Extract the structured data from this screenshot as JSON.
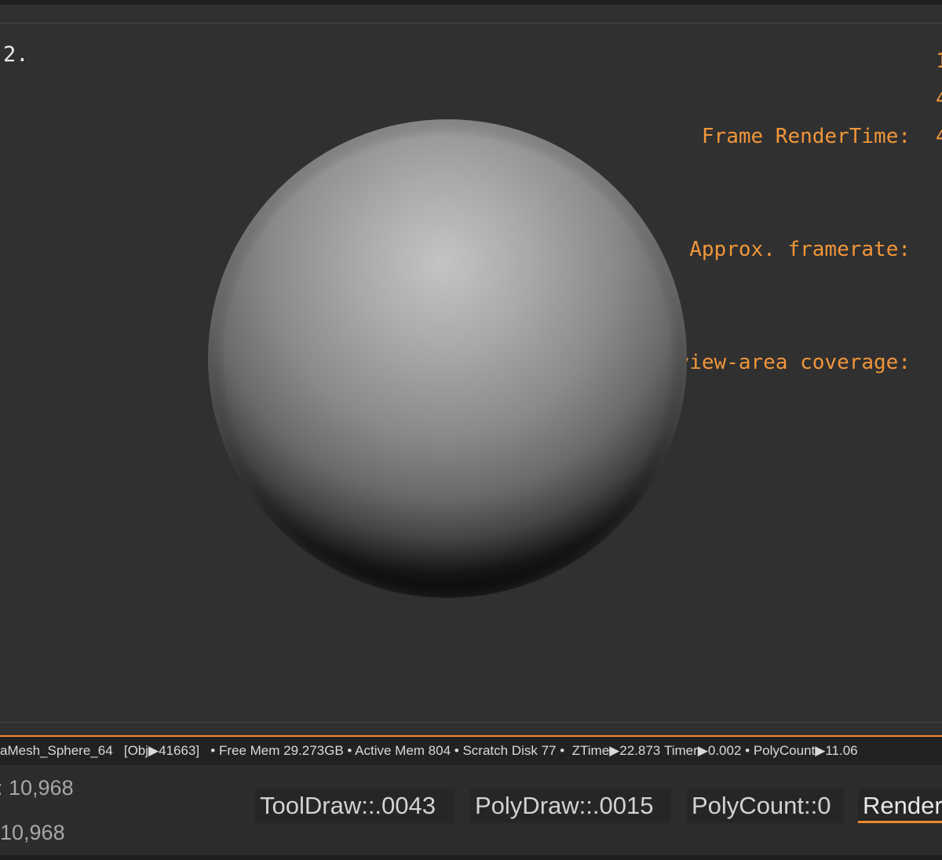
{
  "viewport": {
    "corner_label": "2.",
    "stats": [
      {
        "label": "Frame RenderTime:",
        "value_fragment": "1"
      },
      {
        "label": "Approx. framerate:",
        "value_fragment": "4"
      },
      {
        "label": "Model view-area coverage:",
        "value_fragment": "4"
      }
    ],
    "model": {
      "mesh": "sphere",
      "shading": "matcap-gray"
    }
  },
  "status_bar": {
    "tool_name": "aMesh_Sphere_64",
    "obj": "[Obj▶41663]",
    "free_mem": "• Free Mem 29.273GB",
    "active_mem": "• Active Mem 804",
    "scratch_disk": "• Scratch Disk 77 •",
    "ztime": "ZTime▶22.873",
    "timer": "Timer▶0.002",
    "polycount": "• PolyCount▶11.06"
  },
  "bottom": {
    "left_values": [
      ": 10,968",
      "10,968"
    ],
    "counters": [
      {
        "label": "ToolDraw::.0043",
        "active": false
      },
      {
        "label": "PolyDraw::.0015",
        "active": false
      },
      {
        "label": "PolyCount::0",
        "active": false
      },
      {
        "label": "Render",
        "active": true
      }
    ]
  },
  "colors": {
    "accent": "#f0892b",
    "stats_text": "#f0963a",
    "background": "#303030"
  }
}
